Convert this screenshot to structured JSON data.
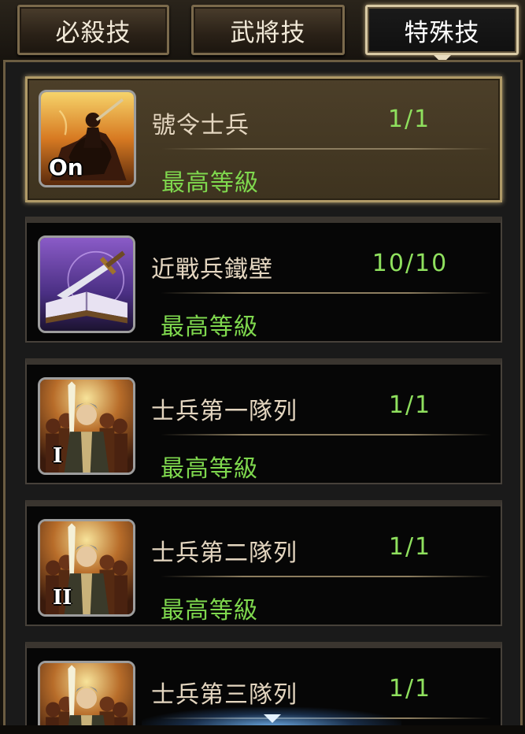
{
  "tabs": [
    {
      "label": "必殺技",
      "active": false
    },
    {
      "label": "武將技",
      "active": false
    },
    {
      "label": "特殊技",
      "active": true
    }
  ],
  "skills": [
    {
      "name": "號令士兵",
      "level": "1/1",
      "status": "最高等級",
      "badge": "On",
      "icon": "mounted-general-icon",
      "selected": true
    },
    {
      "name": "近戰兵鐵壁",
      "level": "10/10",
      "status": "最高等級",
      "badge": "",
      "icon": "sword-on-book-icon",
      "selected": false
    },
    {
      "name": "士兵第一隊列",
      "level": "1/1",
      "status": "最高等級",
      "badge": "I",
      "icon": "soldier-formation-icon",
      "selected": false
    },
    {
      "name": "士兵第二隊列",
      "level": "1/1",
      "status": "最高等級",
      "badge": "II",
      "icon": "soldier-formation-icon",
      "selected": false
    },
    {
      "name": "士兵第三隊列",
      "level": "1/1",
      "status": "",
      "badge": "",
      "icon": "soldier-formation-icon",
      "selected": false
    }
  ],
  "colors": {
    "level_green": "#8fe05e",
    "status_green": "#7fd84e",
    "name_text": "#e4d6c0",
    "selected_border": "#b09a67"
  }
}
